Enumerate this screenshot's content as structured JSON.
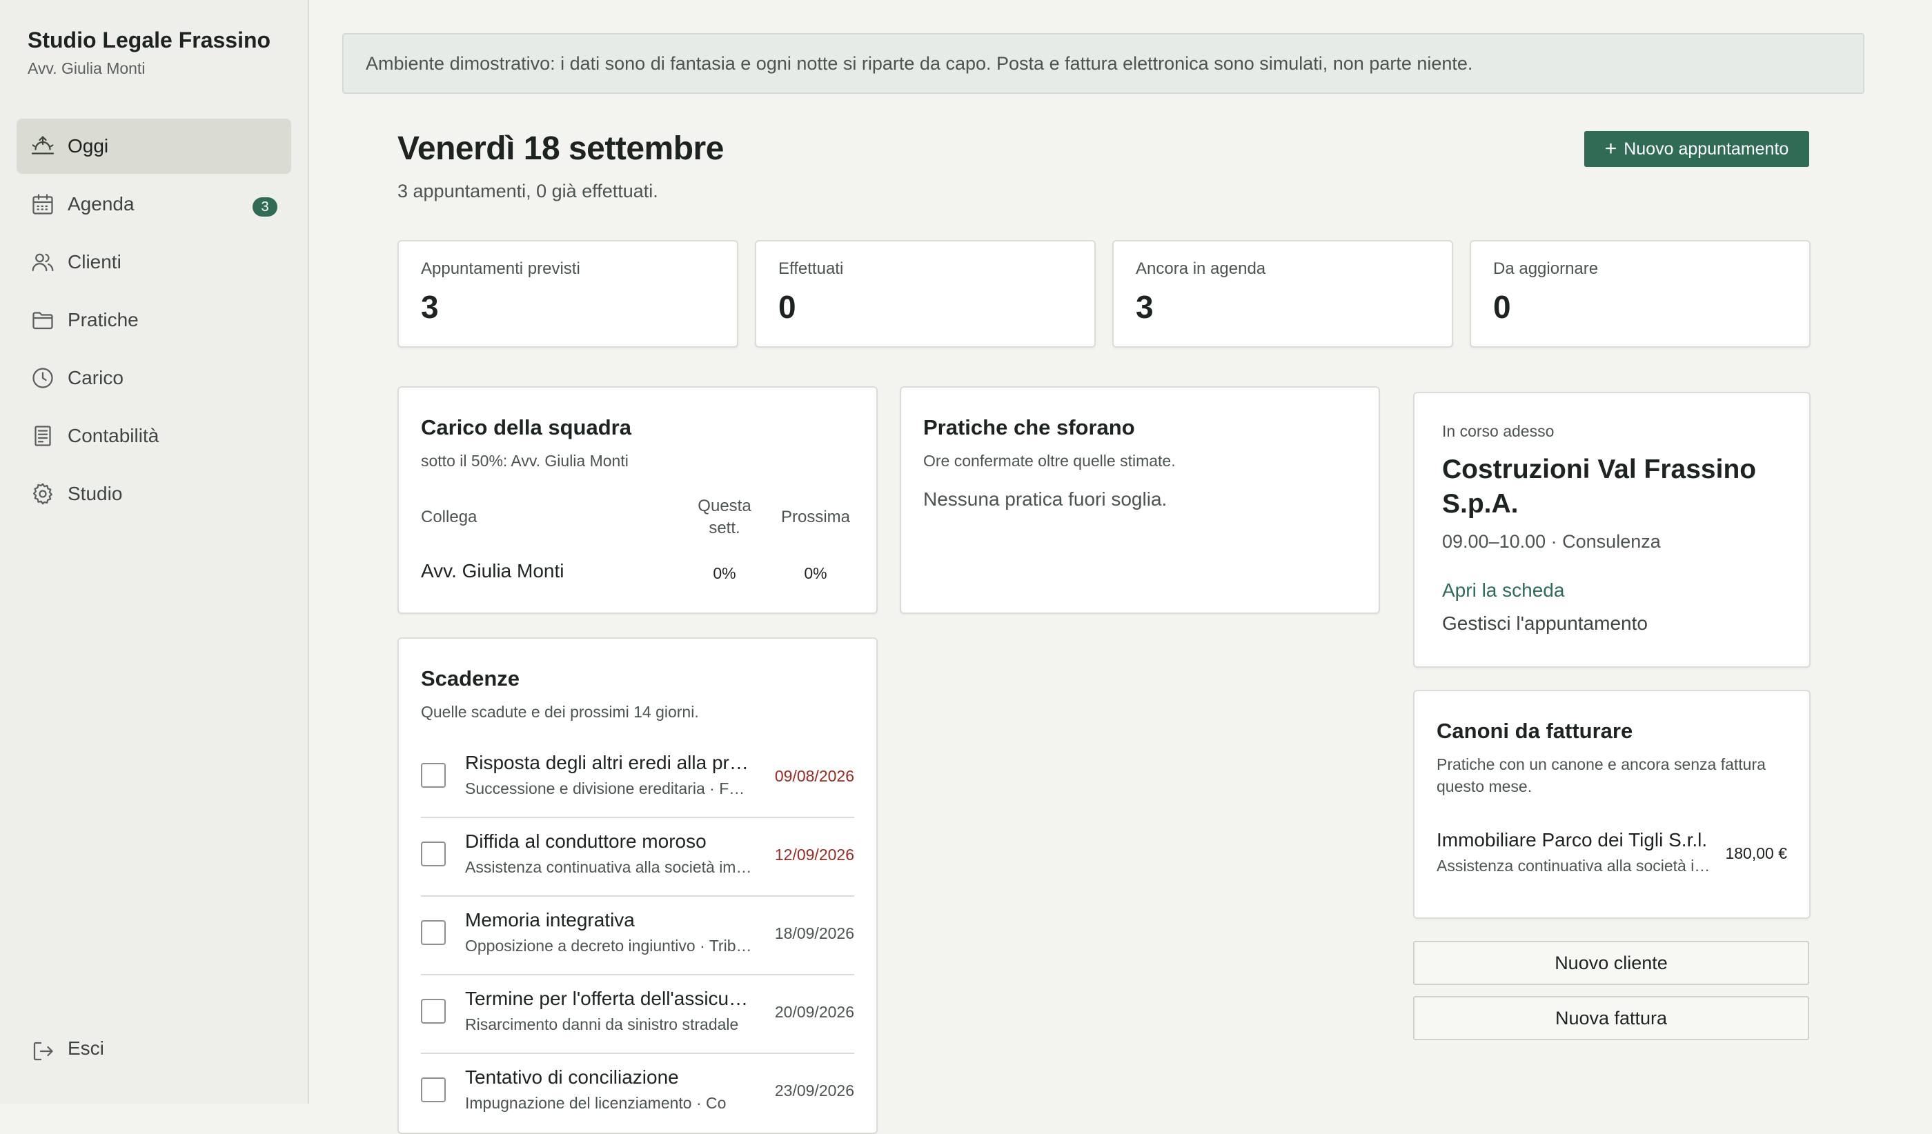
{
  "sidebar": {
    "studio_name": "Studio Legale Frassino",
    "user_name": "Avv. Giulia Monti",
    "items": [
      {
        "label": "Oggi",
        "icon": "sunrise-icon",
        "active": true
      },
      {
        "label": "Agenda",
        "icon": "calendar-icon",
        "badge": "3"
      },
      {
        "label": "Clienti",
        "icon": "users-icon"
      },
      {
        "label": "Pratiche",
        "icon": "folder-icon"
      },
      {
        "label": "Carico",
        "icon": "clock-icon"
      },
      {
        "label": "Contabilità",
        "icon": "receipt-icon"
      },
      {
        "label": "Studio",
        "icon": "gear-icon"
      }
    ],
    "logout_label": "Esci"
  },
  "banner": "Ambiente dimostrativo: i dati sono di fantasia e ogni notte si riparte da capo. Posta e fattura elettronica sono simulati, non parte niente.",
  "header": {
    "title": "Venerdì 18 settembre",
    "subtitle": "3 appuntamenti, 0 già effettuati.",
    "new_appointment_label": "Nuovo appuntamento"
  },
  "stats": [
    {
      "label": "Appuntamenti previsti",
      "value": "3"
    },
    {
      "label": "Effettuati",
      "value": "0"
    },
    {
      "label": "Ancora in agenda",
      "value": "3"
    },
    {
      "label": "Da aggiornare",
      "value": "0"
    }
  ],
  "team_load": {
    "title": "Carico della squadra",
    "subtitle": "sotto il 50%: Avv. Giulia Monti",
    "col_colleague": "Collega",
    "col_this_week": "Questa sett.",
    "col_next": "Prossima",
    "rows": [
      {
        "name": "Avv. Giulia Monti",
        "this_week": "0%",
        "next": "0%"
      }
    ]
  },
  "overruns": {
    "title": "Pratiche che sforano",
    "subtitle": "Ore confermate oltre quelle stimate.",
    "empty": "Nessuna pratica fuori soglia."
  },
  "deadlines": {
    "title": "Scadenze",
    "subtitle": "Quelle scadute e dei prossimi 14 giorni.",
    "items": [
      {
        "title": "Risposta degli altri eredi alla proposta di divisione",
        "meta": "Successione e divisione ereditaria · Famiglia Rinaldi",
        "date": "09/08/2026",
        "overdue": true
      },
      {
        "title": "Diffida al conduttore moroso",
        "meta": "Assistenza continuativa alla società immobiliare",
        "date": "12/09/2026",
        "overdue": true
      },
      {
        "title": "Memoria integrativa",
        "meta": "Opposizione a decreto ingiuntivo · Tribunale",
        "date": "18/09/2026",
        "overdue": false
      },
      {
        "title": "Termine per l'offerta dell'assicurazione",
        "meta": "Risarcimento danni da sinistro stradale",
        "date": "20/09/2026",
        "overdue": false
      },
      {
        "title": "Tentativo di conciliazione",
        "meta": "Impugnazione del licenziamento · Co",
        "date": "23/09/2026",
        "overdue": false
      }
    ]
  },
  "current": {
    "label": "In corso adesso",
    "client": "Costruzioni Val Frassino S.p.A.",
    "time": "09.00–10.00 · Consulenza",
    "open_label": "Apri la scheda",
    "manage_label": "Gestisci l'appuntamento"
  },
  "fees": {
    "title": "Canoni da fatturare",
    "subtitle": "Pratiche con un canone e ancora senza fattura questo mese.",
    "items": [
      {
        "name": "Immobiliare Parco dei Tigli S.r.l.",
        "meta": "Assistenza continuativa alla società immobiliare",
        "amount": "180,00 €"
      }
    ]
  },
  "actions": {
    "new_client": "Nuovo cliente",
    "new_invoice": "Nuova fattura"
  },
  "colors": {
    "accent": "#2f6b55",
    "overdue": "#9a2a22",
    "background": "#f3f3ef",
    "sidebar": "#eeeeea"
  }
}
